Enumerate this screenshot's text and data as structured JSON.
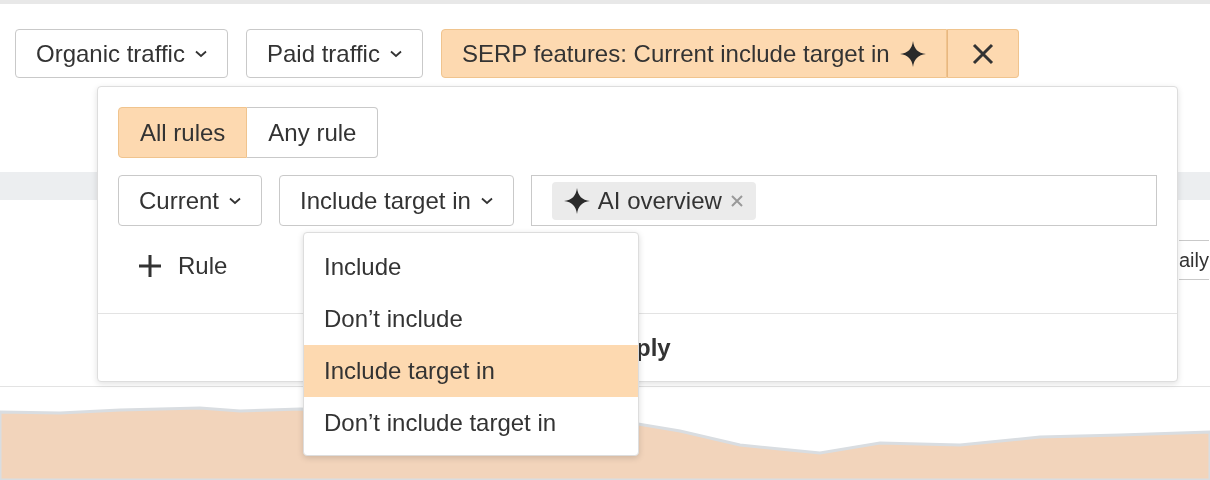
{
  "filters": [
    {
      "label": "Organic traffic",
      "active": false
    },
    {
      "label": "Paid traffic",
      "active": false
    },
    {
      "label": "SERP features: Current include target in",
      "active": true
    }
  ],
  "popover": {
    "match_modes": [
      {
        "label": "All rules",
        "selected": true
      },
      {
        "label": "Any rule",
        "selected": false
      }
    ],
    "rule": {
      "scope": "Current",
      "operator": "Include target in",
      "tags": [
        {
          "label": "AI overview"
        }
      ]
    },
    "add_rule": "Rule",
    "apply": "ply"
  },
  "operator_menu": [
    {
      "label": "Include",
      "selected": false
    },
    {
      "label": "Don’t include",
      "selected": false
    },
    {
      "label": "Include target in",
      "selected": true
    },
    {
      "label": "Don’t include target in",
      "selected": false
    }
  ],
  "side_button": "aily"
}
